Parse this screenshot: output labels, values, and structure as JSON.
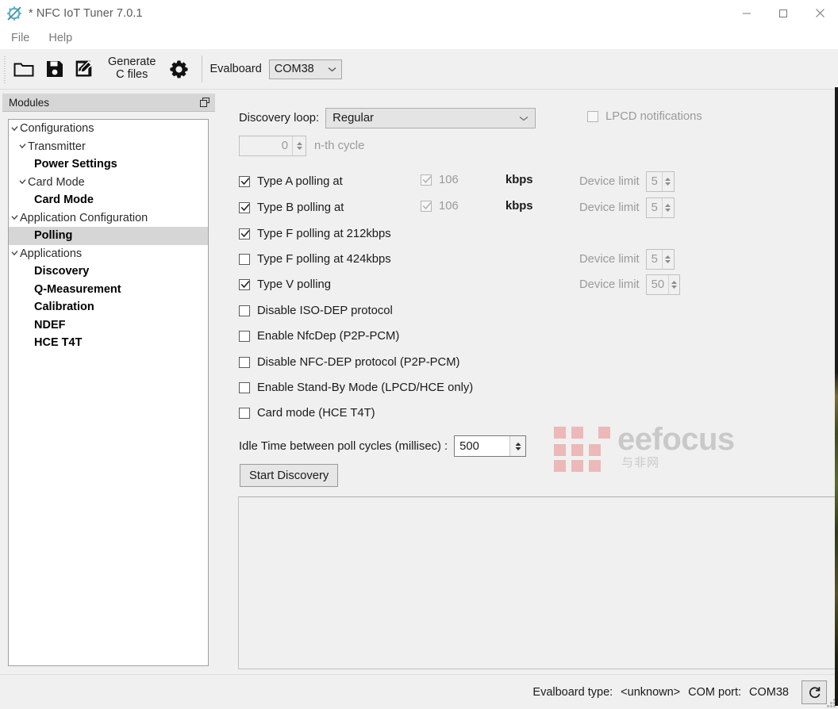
{
  "window": {
    "title": "* NFC IoT Tuner 7.0.1",
    "logo_icon": "nfc-gear-logo-icon",
    "minimize_icon": "minimize-icon",
    "maximize_icon": "maximize-icon",
    "close_icon": "close-icon"
  },
  "menubar": {
    "items": [
      {
        "label": "File"
      },
      {
        "label": "Help"
      }
    ]
  },
  "toolbar": {
    "open_icon": "open-folder-icon",
    "save_icon": "save-floppy-icon",
    "saveas_icon": "save-as-edit-icon",
    "generate_label": "Generate\nC files",
    "settings_icon": "gear-icon",
    "evalboard_label": "Evalboard",
    "com_value": "COM38",
    "com_caret_icon": "chevron-down-icon"
  },
  "dock": {
    "title": "Modules",
    "float_icon": "float-window-icon",
    "tree": [
      {
        "label": "Configurations",
        "type": "group",
        "level": 0,
        "expanded": true
      },
      {
        "label": "Transmitter",
        "type": "group",
        "level": 1,
        "expanded": true
      },
      {
        "label": "Power Settings",
        "type": "leaf",
        "level": 2,
        "selected": false
      },
      {
        "label": "Card Mode",
        "type": "group",
        "level": 1,
        "expanded": true
      },
      {
        "label": "Card Mode",
        "type": "leaf",
        "level": 2,
        "selected": false
      },
      {
        "label": "Application Configuration",
        "type": "group",
        "level": 0,
        "expanded": true
      },
      {
        "label": "Polling",
        "type": "leaf",
        "level": 2,
        "selected": true
      },
      {
        "label": "Applications",
        "type": "group",
        "level": 0,
        "expanded": true
      },
      {
        "label": "Discovery",
        "type": "leaf",
        "level": 2,
        "selected": false
      },
      {
        "label": "Q-Measurement",
        "type": "leaf",
        "level": 2,
        "selected": false
      },
      {
        "label": "Calibration",
        "type": "leaf",
        "level": 2,
        "selected": false
      },
      {
        "label": "NDEF",
        "type": "leaf",
        "level": 2,
        "selected": false
      },
      {
        "label": "HCE T4T",
        "type": "leaf",
        "level": 2,
        "selected": false
      }
    ]
  },
  "main": {
    "discovery_loop_label": "Discovery loop:",
    "discovery_loop_value": "Regular",
    "discovery_loop_caret_icon": "chevron-down-icon",
    "lpcd_label": "LPCD notifications",
    "lpcd_checked": false,
    "lpcd_enabled": false,
    "nth_value": "0",
    "nth_label": "n-th cycle",
    "nth_enabled": false,
    "polling_rows": [
      {
        "label": "Type A polling at",
        "checked": true,
        "rate_value": "106",
        "rate_checked": true,
        "rate_enabled": false,
        "unit": "kbps",
        "devlimit_label": "Device limit",
        "devlimit_value": "5",
        "devlimit_enabled": false
      },
      {
        "label": "Type B polling at",
        "checked": true,
        "rate_value": "106",
        "rate_checked": true,
        "rate_enabled": false,
        "unit": "kbps",
        "devlimit_label": "Device limit",
        "devlimit_value": "5",
        "devlimit_enabled": false
      },
      {
        "label": "Type F polling at 212kbps",
        "checked": true,
        "rate_value": null,
        "unit": null,
        "devlimit_label": null,
        "devlimit_value": null
      },
      {
        "label": "Type F polling at 424kbps",
        "checked": false,
        "rate_value": null,
        "unit": null,
        "devlimit_label": "Device limit",
        "devlimit_value": "5",
        "devlimit_enabled": false
      },
      {
        "label": "Type V polling",
        "checked": true,
        "rate_value": null,
        "unit": null,
        "devlimit_label": "Device limit",
        "devlimit_value": "50",
        "devlimit_enabled": false
      },
      {
        "label": "Disable ISO-DEP protocol",
        "checked": false
      },
      {
        "label": "Enable NfcDep (P2P-PCM)",
        "checked": false
      },
      {
        "label": "Disable NFC-DEP protocol (P2P-PCM)",
        "checked": false
      },
      {
        "label": "Enable Stand-By Mode (LPCD/HCE only)",
        "checked": false
      },
      {
        "label": "Card mode (HCE T4T)",
        "checked": false
      }
    ],
    "idle_label": "Idle Time between poll cycles (millisec) :",
    "idle_value": "500",
    "start_button": "Start Discovery"
  },
  "statusbar": {
    "evalboard_type_label": "Evalboard type:",
    "evalboard_type_value": "<unknown>",
    "com_port_label": "COM port:",
    "com_port_value": "COM38",
    "refresh_icon": "refresh-icon",
    "resize_grip_icon": "resize-grip-icon"
  },
  "watermark": {
    "text": "eefocus",
    "subtext": "与非网"
  },
  "colors": {
    "window_bg": "#f0f0f0",
    "panel_bg": "#ffffff",
    "selection": "#d6d6d6",
    "disabled_text": "#9a9a9a",
    "logo_accent": "#5fb0c4"
  }
}
